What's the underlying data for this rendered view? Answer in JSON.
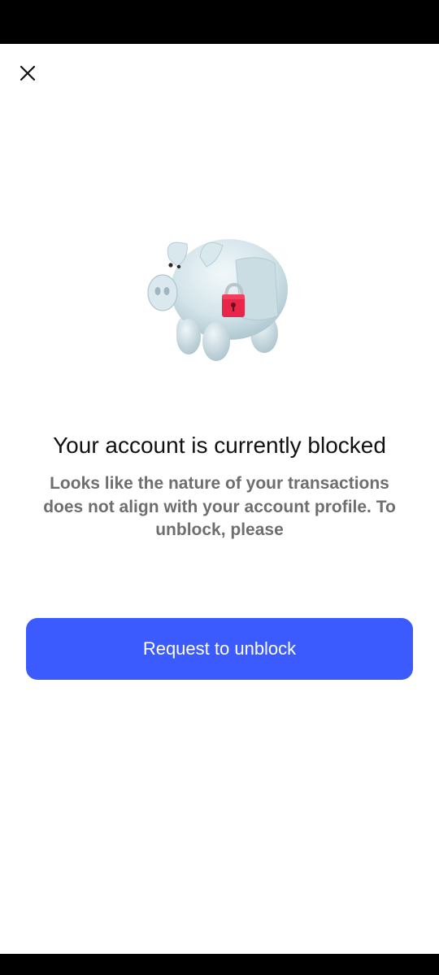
{
  "header": {
    "close_icon": "close-icon"
  },
  "illustration": {
    "icon": "locked-piggy-bank-icon",
    "lock_color": "#e8264a",
    "body_color": "#d6e6ec"
  },
  "main": {
    "title": "Your account is currently blocked",
    "description": "Looks like the nature of your transactions does not align with your account profile. To unblock, please"
  },
  "actions": {
    "primary_label": "Request to unblock",
    "primary_color": "#3b5bff"
  }
}
